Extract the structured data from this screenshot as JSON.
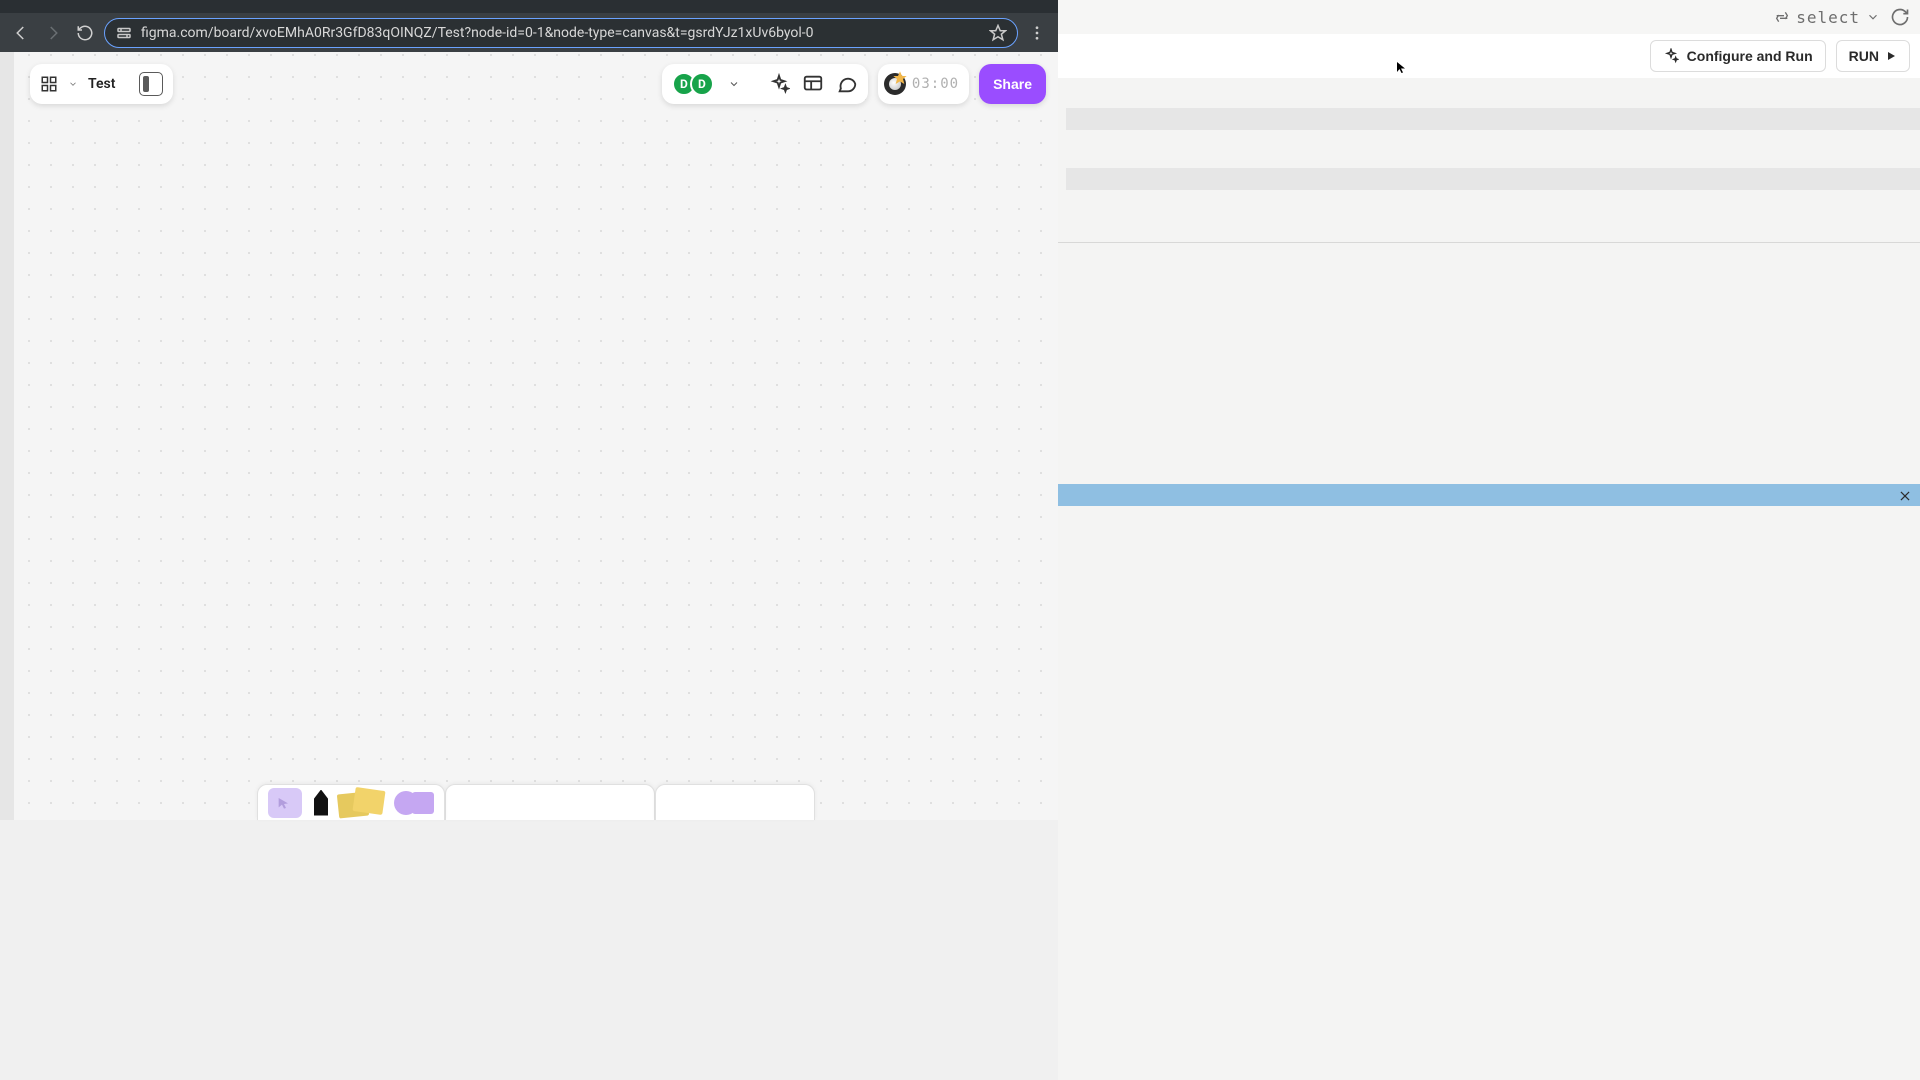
{
  "right_panel": {
    "select_label": "select",
    "configure_label": "Configure and Run",
    "run_label": "RUN"
  },
  "browser": {
    "url": "figma.com/board/xvoEMhA0Rr3GfD83qOINQZ/Test?node-id=0-1&node-type=canvas&t=gsrdYJz1xUv6byol-0"
  },
  "figma": {
    "title": "Test",
    "avatars": [
      "D",
      "D"
    ],
    "timer": "03:00",
    "share_label": "Share"
  }
}
